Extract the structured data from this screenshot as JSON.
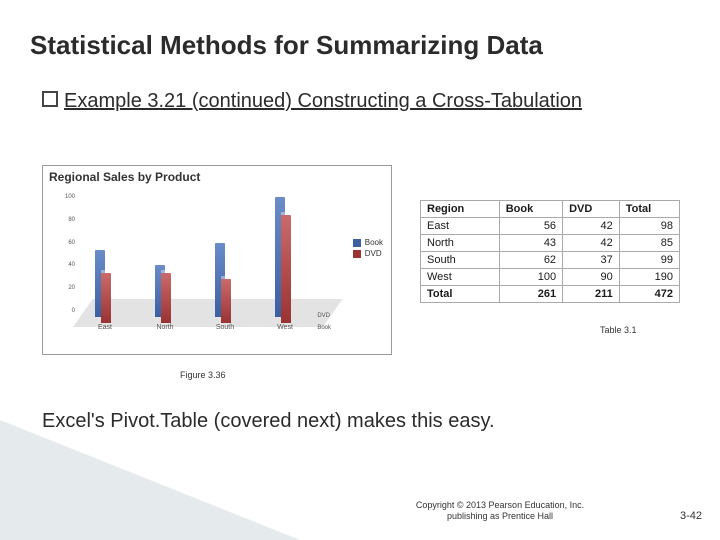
{
  "title": "Statistical Methods for Summarizing Data",
  "bullet": "Example 3.21  (continued) Constructing a Cross-Tabulation",
  "chart_data": {
    "type": "bar",
    "title": "Regional Sales by Product",
    "categories": [
      "East",
      "North",
      "South",
      "West"
    ],
    "series": [
      {
        "name": "Book",
        "values": [
          56,
          43,
          62,
          100
        ],
        "color": "#3a5fa3"
      },
      {
        "name": "DVD",
        "values": [
          42,
          42,
          37,
          90
        ],
        "color": "#9a3333"
      }
    ],
    "ylim": [
      0,
      100
    ],
    "y_ticks": [
      100,
      80,
      60,
      40,
      20,
      0
    ],
    "legend": [
      "Book",
      "DVD"
    ],
    "depth_labels": [
      "DVD",
      "Book"
    ]
  },
  "figure_label": "Figure 3.36",
  "table": {
    "headers": [
      "Region",
      "Book",
      "DVD",
      "Total"
    ],
    "rows": [
      [
        "East",
        "56",
        "42",
        "98"
      ],
      [
        "North",
        "43",
        "42",
        "85"
      ],
      [
        "South",
        "62",
        "37",
        "99"
      ],
      [
        "West",
        "100",
        "90",
        "190"
      ]
    ],
    "total_row": [
      "Total",
      "261",
      "211",
      "472"
    ]
  },
  "table_label": "Table 3.1",
  "body_text": "Excel's Pivot.Table (covered next) makes this easy.",
  "copyright": {
    "line1": "Copyright © 2013 Pearson Education, Inc.",
    "line2": "publishing as Prentice Hall"
  },
  "slide_number": "3-42"
}
